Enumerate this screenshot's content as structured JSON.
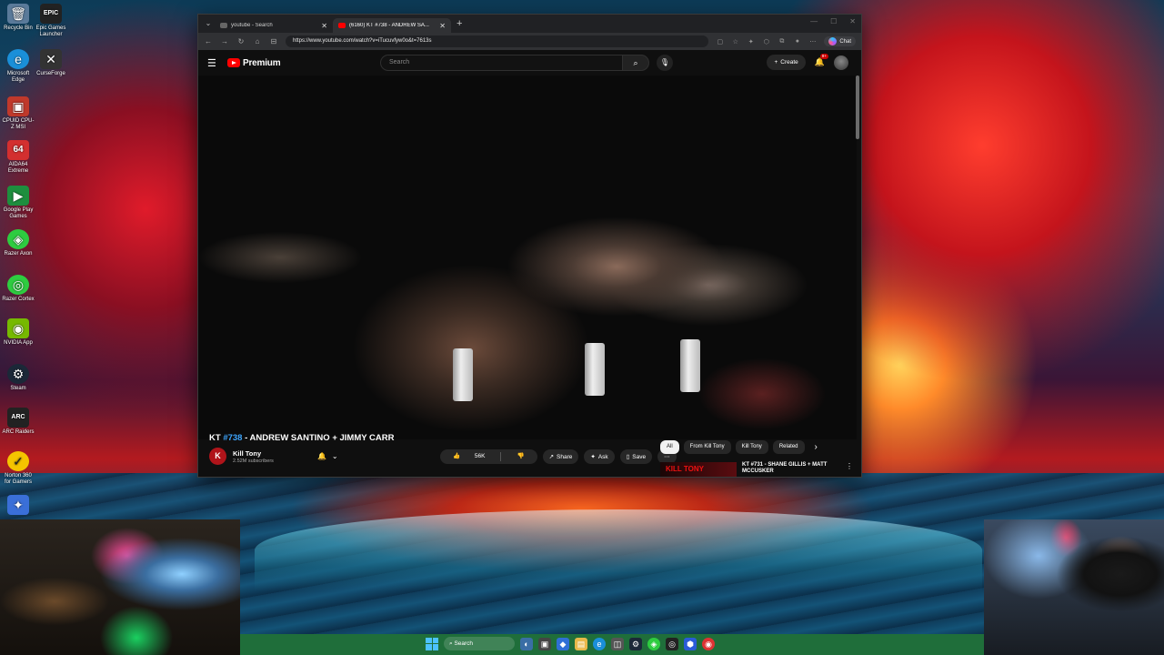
{
  "desktop": {
    "icons": [
      {
        "label": "Recycle Bin",
        "glyph": "🗑",
        "color": "#5a7a9a"
      },
      {
        "label": "Epic Games Launcher",
        "glyph": "EPIC",
        "color": "#222222"
      },
      {
        "label": "Microsoft Edge",
        "glyph": "e",
        "color": "#1a8fd8"
      },
      {
        "label": "CurseForge",
        "glyph": "✕",
        "color": "#333333"
      },
      {
        "label": "CPUID CPU-Z MSI",
        "glyph": "▣",
        "color": "#c0392b"
      },
      {
        "label": "AIDA64 Extreme",
        "glyph": "64",
        "color": "#d32f2f"
      },
      {
        "label": "Google Play Games",
        "glyph": "▶",
        "color": "#1e8e3e"
      },
      {
        "label": "Razer Axon",
        "glyph": "◈",
        "color": "#2ecc40"
      },
      {
        "label": "Razer Cortex",
        "glyph": "◎",
        "color": "#2ecc40"
      },
      {
        "label": "NVIDIA App",
        "glyph": "◉",
        "color": "#76b900"
      },
      {
        "label": "Steam",
        "glyph": "⚙",
        "color": "#1b2838"
      },
      {
        "label": "ARC Raiders",
        "glyph": "ARC",
        "color": "#222222"
      },
      {
        "label": "Norton 360 for Gamers",
        "glyph": "✓",
        "color": "#f5c400"
      },
      {
        "label": "",
        "glyph": "✦",
        "color": "#3a6fd8"
      }
    ]
  },
  "browser": {
    "tabs": [
      {
        "title": "youtube - Search",
        "active": false
      },
      {
        "title": "(6160) KT #738 - ANDREW SA...",
        "active": true
      }
    ],
    "url": "https://www.youtube.com/watch?v=iTucuvfyw0o&t=7613s",
    "copilot_label": "Chat"
  },
  "youtube": {
    "logo_text": "Premium",
    "search_placeholder": "Search",
    "create_label": "Create",
    "notif_badge": "9+",
    "video": {
      "title_prefix": "KT ",
      "title_number": "#738",
      "title_rest": " - ANDREW SANTINO + JIMMY CARR",
      "channel_name": "Kill Tony",
      "channel_initial": "K",
      "subscribers": "2.52M subscribers",
      "likes": "56K",
      "share_label": "Share",
      "ask_label": "Ask",
      "save_label": "Save"
    },
    "chips": [
      "All",
      "From Kill Tony",
      "Kill Tony",
      "Related"
    ],
    "recommended": {
      "thumb_text": "KILL TONY",
      "title": "KT #731 - SHANE GILLIS + MATT MCCUSKER"
    }
  },
  "taskbar": {
    "search_label": "Search"
  }
}
